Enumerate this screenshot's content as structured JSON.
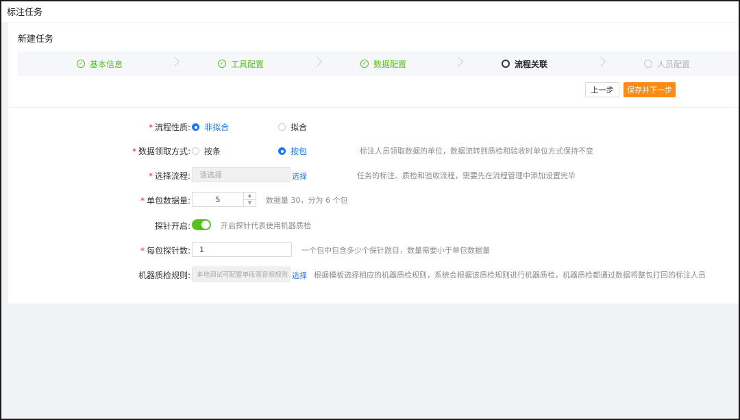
{
  "app": {
    "title": "标注任务"
  },
  "card": {
    "title": "新建任务"
  },
  "steps": [
    {
      "label": "基本信息",
      "status": "done"
    },
    {
      "label": "工具配置",
      "status": "done"
    },
    {
      "label": "数据配置",
      "status": "done"
    },
    {
      "label": "流程关联",
      "status": "active"
    },
    {
      "label": "人员配置",
      "status": "todo"
    }
  ],
  "actions": {
    "prev_label": "上一步",
    "next_label": "保存并下一步"
  },
  "form": {
    "nature": {
      "label": "流程性质:",
      "options": [
        "非拟合",
        "拟合"
      ],
      "selected": "非拟合"
    },
    "fetch_mode": {
      "label": "数据领取方式:",
      "options": [
        "按条",
        "按包"
      ],
      "selected": "按包",
      "hint": "标注人员领取数据的单位，数据流转到质检和验收时单位方式保持不变"
    },
    "flow": {
      "label": "选择流程:",
      "placeholder": "请选择",
      "link": "选择",
      "hint": "任务的标注、质检和验收流程，需要先在流程管理中添加设置完毕"
    },
    "package_size": {
      "label": "单包数据量:",
      "value": "5",
      "hint": "数据量 30，分为 6 个包"
    },
    "probe": {
      "label": "探针开启:",
      "enabled": true,
      "hint": "开启探针代表使用机器质检"
    },
    "probes_per_package": {
      "label": "每包探针数:",
      "value": "1",
      "hint": "一个包中包含多少个探针题目，数量需要小于单包数据量"
    },
    "qc_rule": {
      "label": "机器质检规则:",
      "placeholder": "本地调试可配置单段落音频规则",
      "link": "选择",
      "hint": "根据模板选择相应的机器质检规则，系统会根据该质检规则进行机器质检，机器质检都通过数据将整包打回的标注人员"
    }
  },
  "colors": {
    "primary": "#1677ff",
    "success": "#52c41a",
    "warning": "#fa8c16",
    "danger": "#f5222d"
  }
}
